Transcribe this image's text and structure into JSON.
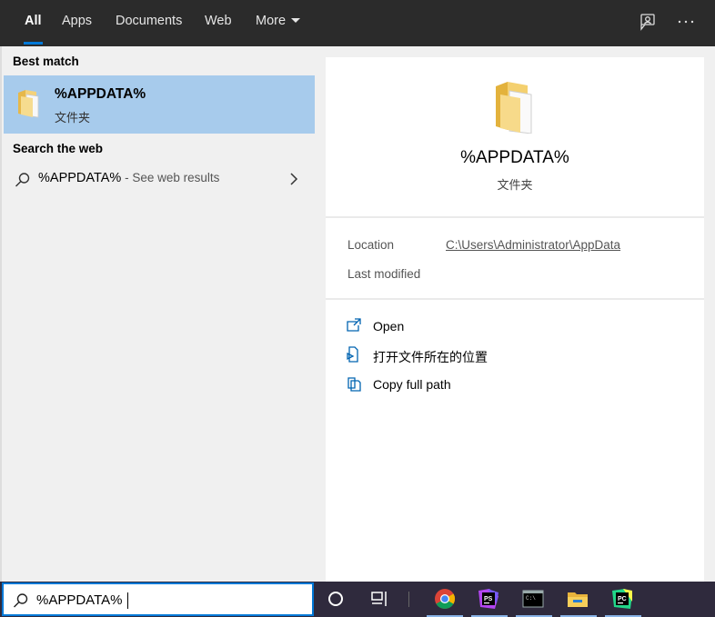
{
  "tabs": [
    {
      "label": "All",
      "active": true
    },
    {
      "label": "Apps",
      "active": false
    },
    {
      "label": "Documents",
      "active": false
    },
    {
      "label": "Web",
      "active": false
    },
    {
      "label": "More",
      "active": false
    }
  ],
  "top_icons": [
    "feedback-icon",
    "more-options-icon"
  ],
  "best_match": {
    "section_label": "Best match",
    "title": "%APPDATA%",
    "subtitle": "文件夹",
    "icon": "folder-icon"
  },
  "web_search": {
    "section_label": "Search the web",
    "query": "%APPDATA%",
    "suffix": " - See web results",
    "icon": "search-icon"
  },
  "preview": {
    "title": "%APPDATA%",
    "subtitle": "文件夹",
    "location_label": "Location",
    "location_value": "C:\\Users\\Administrator\\AppData",
    "modified_label": "Last modified",
    "actions": [
      {
        "label": "Open",
        "icon": "open-icon"
      },
      {
        "label": "打开文件所在的位置",
        "icon": "file-location-icon"
      },
      {
        "label": "Copy full path",
        "icon": "copy-icon"
      }
    ]
  },
  "search_box": {
    "value": "%APPDATA%",
    "icon": "search-icon"
  },
  "taskbar_icons": [
    "cortana-icon",
    "task-view-icon",
    "chrome-icon",
    "phpstorm-icon",
    "terminal-icon",
    "file-explorer-icon",
    "pycharm-icon"
  ],
  "colors": {
    "accent": "#0078d7",
    "selected_row": "#a7cbec",
    "topbar": "#2b2b2b",
    "taskbar": "#2f2a3d"
  }
}
